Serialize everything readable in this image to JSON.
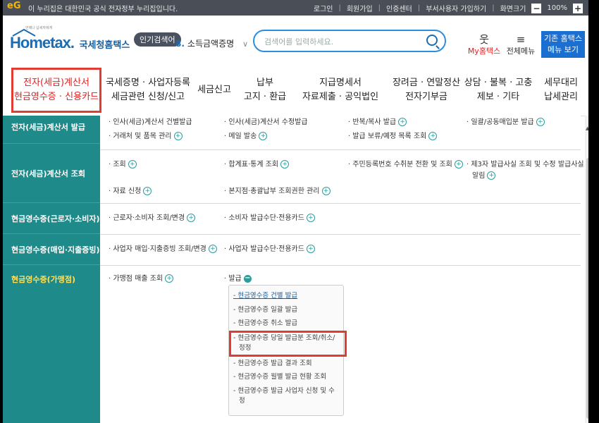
{
  "topbar": {
    "logo": "eG",
    "gov_text": "이 누리집은 대한민국 공식 전자정부 누리집입니다.",
    "links": [
      "로그인",
      "회원가입",
      "인증센터",
      "부서사용자 가입하기",
      "화면크기"
    ],
    "zoom_minus": "−",
    "zoom": "100%",
    "zoom_plus": "+"
  },
  "header": {
    "logo_tiny": "언제나 납세자에게",
    "logo_main": "Hometax.",
    "logo_kr": "국세청홈택스",
    "popular_label": "인기검색어",
    "rank_num": "8.",
    "rank_term": "소득금액증명",
    "rank_chevron": "∨",
    "search_placeholder": "검색어를 입력하세요.",
    "myhome_icon": "웃",
    "myhome_label": "My홈택스",
    "allmenu_icon": "≡",
    "allmenu_label": "전체메뉴",
    "classic_line1": "기존 홈택스",
    "classic_line2": "메뉴 보기"
  },
  "gnb": [
    {
      "l1": "전자(세금)계산서",
      "l2": "현금영수증 · 신용카드"
    },
    {
      "l1": "국세증명 · 사업자등록",
      "l2": "세금관련 신청/신고"
    },
    {
      "l1": "세금신고",
      "l2": ""
    },
    {
      "l1": "납부",
      "l2": "고지 · 환급"
    },
    {
      "l1": "지급명세서",
      "l2": "자료제출 · 공익법인"
    },
    {
      "l1": "장려금 · 연말정산",
      "l2": "전자기부금"
    },
    {
      "l1": "상담 · 불복 · 고충",
      "l2": "제보 · 기타"
    },
    {
      "l1": "세무대리",
      "l2": "납세관리"
    }
  ],
  "side": [
    {
      "label": "전자(세금)계산서 발급"
    },
    {
      "label": "전자(세금)계산서 조회"
    },
    {
      "label": "현금영수증(근로자·소비자)"
    },
    {
      "label": "현금영수증(매입·지출증빙)"
    },
    {
      "label": "현금영수증(가맹점)"
    }
  ],
  "content": {
    "r1": [
      "· 인사(세금)계산서 건별발급",
      "· 인사(세금)계산서 수정발급",
      "· 반복/복사 발급",
      "· 일괄/공동매입분 발급",
      "· 거래처 및 품목 관리",
      "· 메일 발송",
      "· 발급 보류/예정 목록 조회"
    ],
    "r2": [
      "· 조회",
      "· 합계표·통계 조회",
      "· 주민등록번호 수취분 전환 및 조회",
      "· 제3자 발급사실 조회 및 수정 발급사실",
      "알림",
      "· 자료 신청",
      "· 본지점·총괄납부 조회권한 관리"
    ],
    "r3": [
      "· 근로자·소비자 조회/변경",
      "· 소비자 발급수단·전용카드"
    ],
    "r4": [
      "· 사업자 매입·지출증빙 조회/변경",
      "· 사업자 발급수단·전용카드"
    ],
    "r5": [
      "· 가맹점 매출 조회",
      "· 발급"
    ],
    "plus": "+",
    "minus": "−"
  },
  "dropdown": [
    "- 현금영수증 건별 발급",
    "- 현금영수증 일괄 발급",
    "- 현금영수증 취소 발급",
    "- 현금영수증 당일 발급분 조회/취소/",
    "정정",
    "- 현금영수증 발급 결과 조회",
    "- 현금영수증 월별 발급 현황 조회",
    "- 현금영수증 발급 사업자 신청 및 수",
    "정"
  ],
  "scroll_up": "▲"
}
